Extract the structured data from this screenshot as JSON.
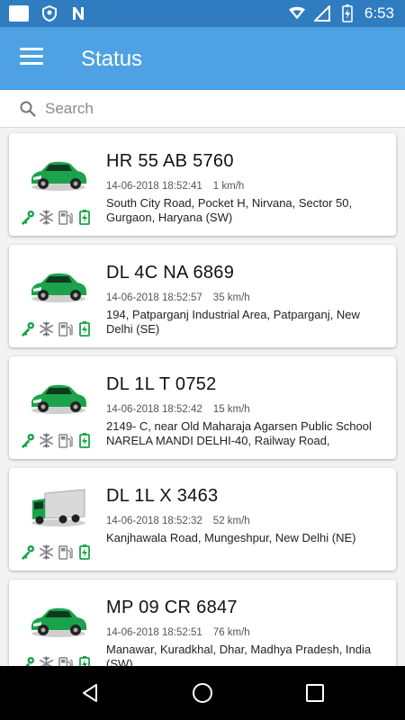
{
  "status_bar": {
    "time": "6:53"
  },
  "app_bar": {
    "title": "Status"
  },
  "search": {
    "placeholder": "Search",
    "value": ""
  },
  "colors": {
    "app_bar": "#4ea1e2",
    "status_bar": "#2f7cc0",
    "icon_green": "#1aa34a",
    "icon_gray": "#888888"
  },
  "vehicles": [
    {
      "type": "car",
      "plate": "HR 55 AB 5760",
      "timestamp": "14-06-2018 18:52:41",
      "speed": "1 km/h",
      "address": "South City Road, Pocket H, Nirvana, Sector 50, Gurgaon, Haryana (SW)"
    },
    {
      "type": "car",
      "plate": "DL 4C NA 6869",
      "timestamp": "14-06-2018 18:52:57",
      "speed": "35 km/h",
      "address": "194, Patparganj Industrial Area, Patparganj, New Delhi (SE)"
    },
    {
      "type": "car",
      "plate": "DL 1L T 0752",
      "timestamp": "14-06-2018 18:52:42",
      "speed": "15 km/h",
      "address": "2149- C, near Old Maharaja Agarsen Public School NARELA MANDI DELHI-40, Railway Road,"
    },
    {
      "type": "truck",
      "plate": "DL 1L X 3463",
      "timestamp": "14-06-2018 18:52:32",
      "speed": "52 km/h",
      "address": "Kanjhawala Road, Mungeshpur, New Delhi (NE)"
    },
    {
      "type": "car",
      "plate": "MP 09 CR 6847",
      "timestamp": "14-06-2018 18:52:51",
      "speed": "76 km/h",
      "address": "Manawar, Kuradkhal, Dhar, Madhya Pradesh, India (SW)"
    }
  ]
}
